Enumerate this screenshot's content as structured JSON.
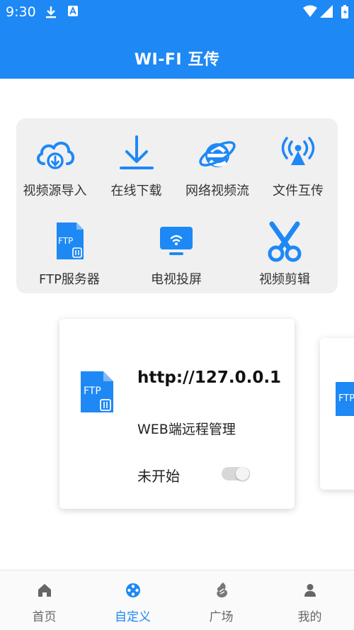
{
  "status_bar": {
    "time": "9:30"
  },
  "header": {
    "title": "WI-FI 互传"
  },
  "features": [
    {
      "label": "视频源导入",
      "icon": "cloud-download-icon"
    },
    {
      "label": "在线下载",
      "icon": "download-arrow-icon"
    },
    {
      "label": "网络视频流",
      "icon": "internet-explorer-icon"
    },
    {
      "label": "文件互传",
      "icon": "wireless-transfer-icon"
    },
    {
      "label": "FTP服务器",
      "icon": "ftp-file-icon"
    },
    {
      "label": "电视投屏",
      "icon": "tv-cast-icon"
    },
    {
      "label": "视频剪辑",
      "icon": "scissors-icon"
    }
  ],
  "server_card": {
    "url": "http://127.0.0.1",
    "description": "WEB端远程管理",
    "status": "未开始",
    "toggle_on": false,
    "file_icon_text": "FTP"
  },
  "bottom_nav": [
    {
      "label": "首页",
      "icon": "home-icon",
      "active": false
    },
    {
      "label": "自定义",
      "icon": "film-reel-icon",
      "active": true
    },
    {
      "label": "广场",
      "icon": "plaza-icon",
      "active": false
    },
    {
      "label": "我的",
      "icon": "person-icon",
      "active": false
    }
  ],
  "colors": {
    "accent": "#1e88f5",
    "inactive": "#666666"
  }
}
